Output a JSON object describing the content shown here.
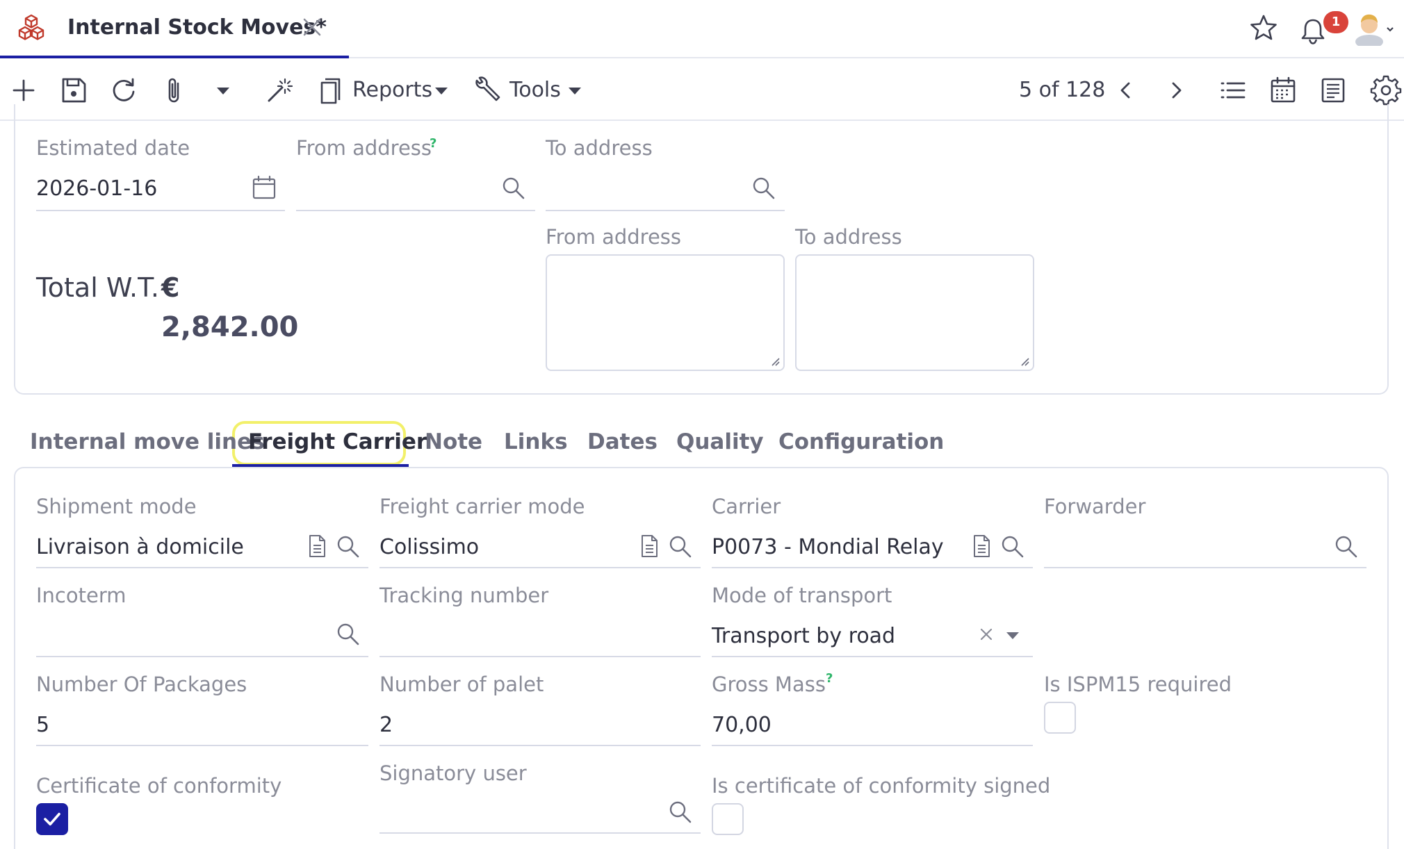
{
  "tab": {
    "title": "Internal Stock Moves*",
    "notifications": "1"
  },
  "toolbar": {
    "reports_label": "Reports",
    "tools_label": "Tools",
    "pager": "5 of 128"
  },
  "header_form": {
    "estimated_date_label": "Estimated date",
    "estimated_date_value": "2026-01-16",
    "from_address_label": "From address",
    "from_address_help": "?",
    "to_address_label": "To address",
    "from_address_text_label": "From address",
    "to_address_text_label": "To address",
    "total_wt_label": "Total W.T.",
    "total_currency": "€",
    "total_value": "2,842.00"
  },
  "form_tabs": [
    {
      "label": "Internal move lines"
    },
    {
      "label": "Freight Carrier"
    },
    {
      "label": "Note"
    },
    {
      "label": "Links"
    },
    {
      "label": "Dates"
    },
    {
      "label": "Quality"
    },
    {
      "label": "Configuration"
    }
  ],
  "freight": {
    "shipment_mode_label": "Shipment mode",
    "shipment_mode_value": "Livraison à domicile",
    "freight_carrier_mode_label": "Freight carrier mode",
    "freight_carrier_mode_value": "Colissimo",
    "carrier_label": "Carrier",
    "carrier_value": "P0073 - Mondial Relay",
    "forwarder_label": "Forwarder",
    "incoterm_label": "Incoterm",
    "tracking_number_label": "Tracking number",
    "mode_of_transport_label": "Mode of transport",
    "mode_of_transport_value": "Transport by road",
    "number_of_packages_label": "Number Of Packages",
    "number_of_packages_value": "5",
    "number_of_palet_label": "Number of palet",
    "number_of_palet_value": "2",
    "gross_mass_label": "Gross Mass",
    "gross_mass_help": "?",
    "gross_mass_value": "70,00",
    "ispm15_label": "Is ISPM15 required",
    "certificate_label": "Certificate of conformity",
    "signatory_user_label": "Signatory user",
    "certificate_signed_label": "Is certificate of conformity signed"
  }
}
